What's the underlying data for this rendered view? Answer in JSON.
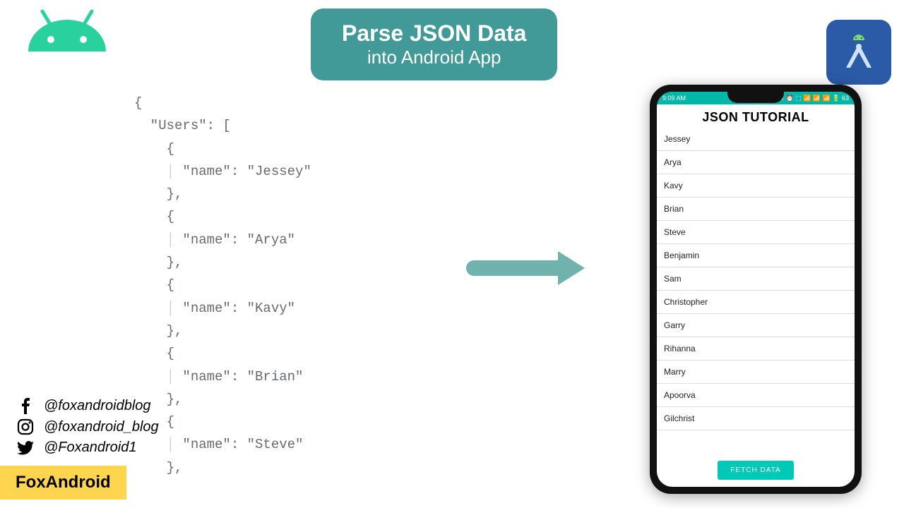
{
  "title": {
    "line1": "Parse JSON Data",
    "line2": "into Android App"
  },
  "code_lines": [
    "{",
    "  \"Users\": [",
    "    {",
    "      \"name\": \"Jessey\"",
    "    },",
    "    {",
    "      \"name\": \"Arya\"",
    "    },",
    "    {",
    "      \"name\": \"Kavy\"",
    "    },",
    "    {",
    "      \"name\": \"Brian\"",
    "    },",
    "    {",
    "      \"name\": \"Steve\"",
    "    },"
  ],
  "phone": {
    "status_time": "9:09 AM",
    "status_right": "46/s ✱ ⏰ ⬚ 📶 📶 📶 🔋 63",
    "app_title": "JSON TUTORIAL",
    "list": [
      "Jessey",
      "Arya",
      "Kavy",
      "Brian",
      "Steve",
      "Benjamin",
      "Sam",
      "Christopher",
      "Garry",
      "Rihanna",
      "Marry",
      "Apoorva",
      "Gilchrist"
    ],
    "button": "FETCH DATA"
  },
  "socials": {
    "facebook": "@foxandroidblog",
    "instagram": "@foxandroid_blog",
    "twitter": "@Foxandroid1"
  },
  "brand": "FoxAndroid"
}
